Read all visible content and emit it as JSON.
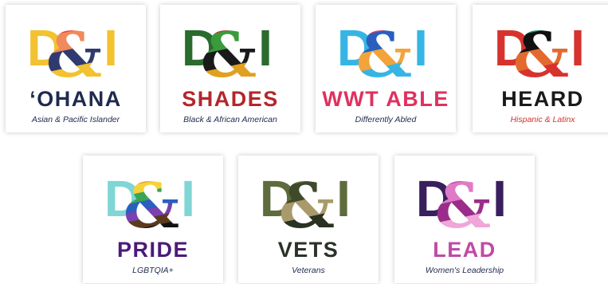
{
  "groups": [
    {
      "logo_text": "D&I",
      "title": "‘OHANA",
      "subtitle": "Asian & Pacific Islander",
      "title_color": "#1f2a4e",
      "subtitle_color": "#1f2a4e",
      "d_color": "#f2c230",
      "i_color": "#f2c230",
      "pattern_colors": [
        "#e8453c",
        "#f08a5d",
        "#2f3b70",
        "#f2c230"
      ]
    },
    {
      "logo_text": "D&I",
      "title": "SHADES",
      "subtitle": "Black & African American",
      "title_color": "#b4262b",
      "subtitle_color": "#1f2a4e",
      "d_color": "#2a6b2e",
      "i_color": "#2a6b2e",
      "pattern_colors": [
        "#c0392b",
        "#3a9b3c",
        "#1a1a1a",
        "#e0a020"
      ]
    },
    {
      "logo_text": "D&I",
      "title": "WWT ABLE",
      "subtitle": "Differently Abled",
      "title_color": "#e0315e",
      "subtitle_color": "#1f2a4e",
      "d_color": "#36b5e5",
      "i_color": "#36b5e5",
      "pattern_colors": [
        "#e63950",
        "#2a5fc0",
        "#f2a33a",
        "#36b5e5"
      ]
    },
    {
      "logo_text": "D&I",
      "title": "HEARD",
      "subtitle": "Hispanic & Latinx",
      "title_color": "#1a1a1a",
      "subtitle_color": "#d6332e",
      "d_color": "#d6332e",
      "i_color": "#d6332e",
      "pattern_colors": [
        "#1c8f74",
        "#111111",
        "#e36a2f",
        "#d6332e"
      ]
    },
    {
      "logo_text": "D&I",
      "title": "PRIDE",
      "subtitle": "LGBTQIA+",
      "title_color": "#4b1a7a",
      "subtitle_color": "#1f2a4e",
      "d_color": "#7fd6d4",
      "i_color": "#7fd6d4",
      "pattern_colors": [
        "#e23b3b",
        "#f29a2e",
        "#f5d33a",
        "#3aa555",
        "#2a5fc0",
        "#7a3fb0",
        "#5b3a1e",
        "#111111"
      ]
    },
    {
      "logo_text": "D&I",
      "title": "VETS",
      "subtitle": "Veterans",
      "title_color": "#2a3228",
      "subtitle_color": "#1f2a4e",
      "d_color": "#5e6b3c",
      "i_color": "#5e6b3c",
      "pattern_colors": [
        "#6b7a45",
        "#3e4a2a",
        "#a89a6a",
        "#2a3222"
      ]
    },
    {
      "logo_text": "D&I",
      "title": "LEAD",
      "subtitle": "Women's Leadership",
      "title_color": "#c04aa6",
      "subtitle_color": "#1f2a4e",
      "d_color": "#3a1f5e",
      "i_color": "#3a1f5e",
      "pattern_colors": [
        "#c04aa6",
        "#e07ac6",
        "#9a2d8a",
        "#f0a6d8"
      ]
    }
  ]
}
